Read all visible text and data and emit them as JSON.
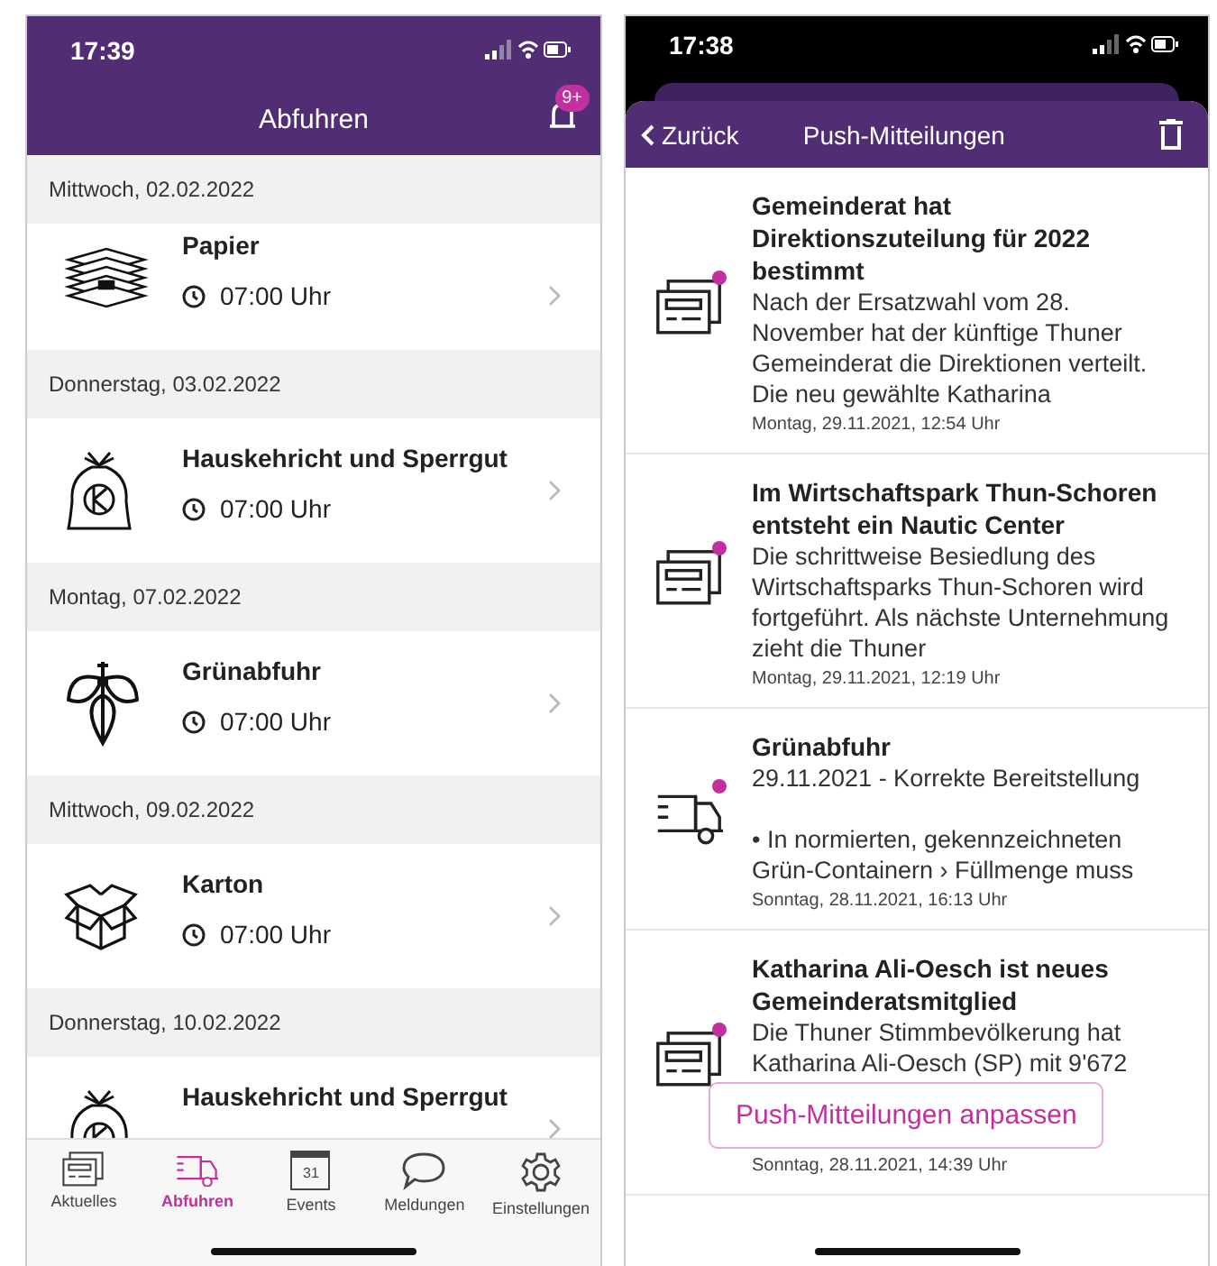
{
  "left_phone": {
    "status_bar": {
      "time": "17:39"
    },
    "header": {
      "title": "Abfuhren",
      "badge": "9+"
    },
    "sections": [
      {
        "date": "Mittwoch, 02.02.2022",
        "item": {
          "kind": "paper",
          "title": "Papier",
          "time": "07:00 Uhr"
        }
      },
      {
        "date": "Donnerstag, 03.02.2022",
        "item": {
          "kind": "bag",
          "title": "Hauskehricht und Sperrgut",
          "time": "07:00 Uhr"
        }
      },
      {
        "date": "Montag, 07.02.2022",
        "item": {
          "kind": "leaves",
          "title": "Grünabfuhr",
          "time": "07:00 Uhr"
        }
      },
      {
        "date": "Mittwoch, 09.02.2022",
        "item": {
          "kind": "box",
          "title": "Karton",
          "time": "07:00 Uhr"
        }
      },
      {
        "date": "Donnerstag, 10.02.2022",
        "item": {
          "kind": "bag",
          "title": "Hauskehricht und Sperrgut"
        }
      }
    ],
    "tabs": [
      {
        "kind": "news",
        "label": "Aktuelles",
        "selected": false
      },
      {
        "kind": "truck",
        "label": "Abfuhren",
        "selected": true
      },
      {
        "kind": "calendar",
        "label": "Events",
        "icon_text": "31",
        "selected": false
      },
      {
        "kind": "chat",
        "label": "Meldungen",
        "selected": false
      },
      {
        "kind": "gear",
        "label": "Einstellungen",
        "selected": false
      }
    ]
  },
  "right_phone": {
    "status_bar": {
      "time": "17:38"
    },
    "header": {
      "back": "Zurück",
      "title": "Push-Mitteilungen"
    },
    "notifications": [
      {
        "kind": "news",
        "unread": true,
        "title": "Gemeinderat hat Direktionszuteilung für 2022 bestimmt",
        "body": "Nach der Ersatzwahl vom 28. November hat der künftige Thuner Gemeinderat die Direktionen verteilt. Die neu gewählte Katharina",
        "date": "Montag, 29.11.2021, 12:54 Uhr"
      },
      {
        "kind": "news",
        "unread": true,
        "title": "Im Wirtschaftspark Thun-Schoren entsteht ein Nautic Center",
        "body": "Die schrittweise Besiedlung des Wirtschaftsparks Thun-Schoren wird fortgeführt. Als nächste Unternehmung zieht die Thuner",
        "date": "Montag, 29.11.2021, 12:19 Uhr"
      },
      {
        "kind": "truck",
        "unread": true,
        "title": "Grünabfuhr",
        "body": "29.11.2021 - Korrekte Bereitstellung\n\n• In normierten, gekennzeichneten Grün-Containern › Füllmenge muss",
        "date": "Sonntag, 28.11.2021, 16:13 Uhr"
      },
      {
        "kind": "news",
        "unread": true,
        "title": "Katharina Ali-Oesch ist neues Gemeinderatsmitglied",
        "body": "Die Thuner Stimmbevölkerung hat Katharina Ali-Oesch (SP) mit 9'672",
        "date": "Sonntag, 28.11.2021, 14:39 Uhr"
      }
    ],
    "floating_button": "Push-Mitteilungen anpassen"
  }
}
